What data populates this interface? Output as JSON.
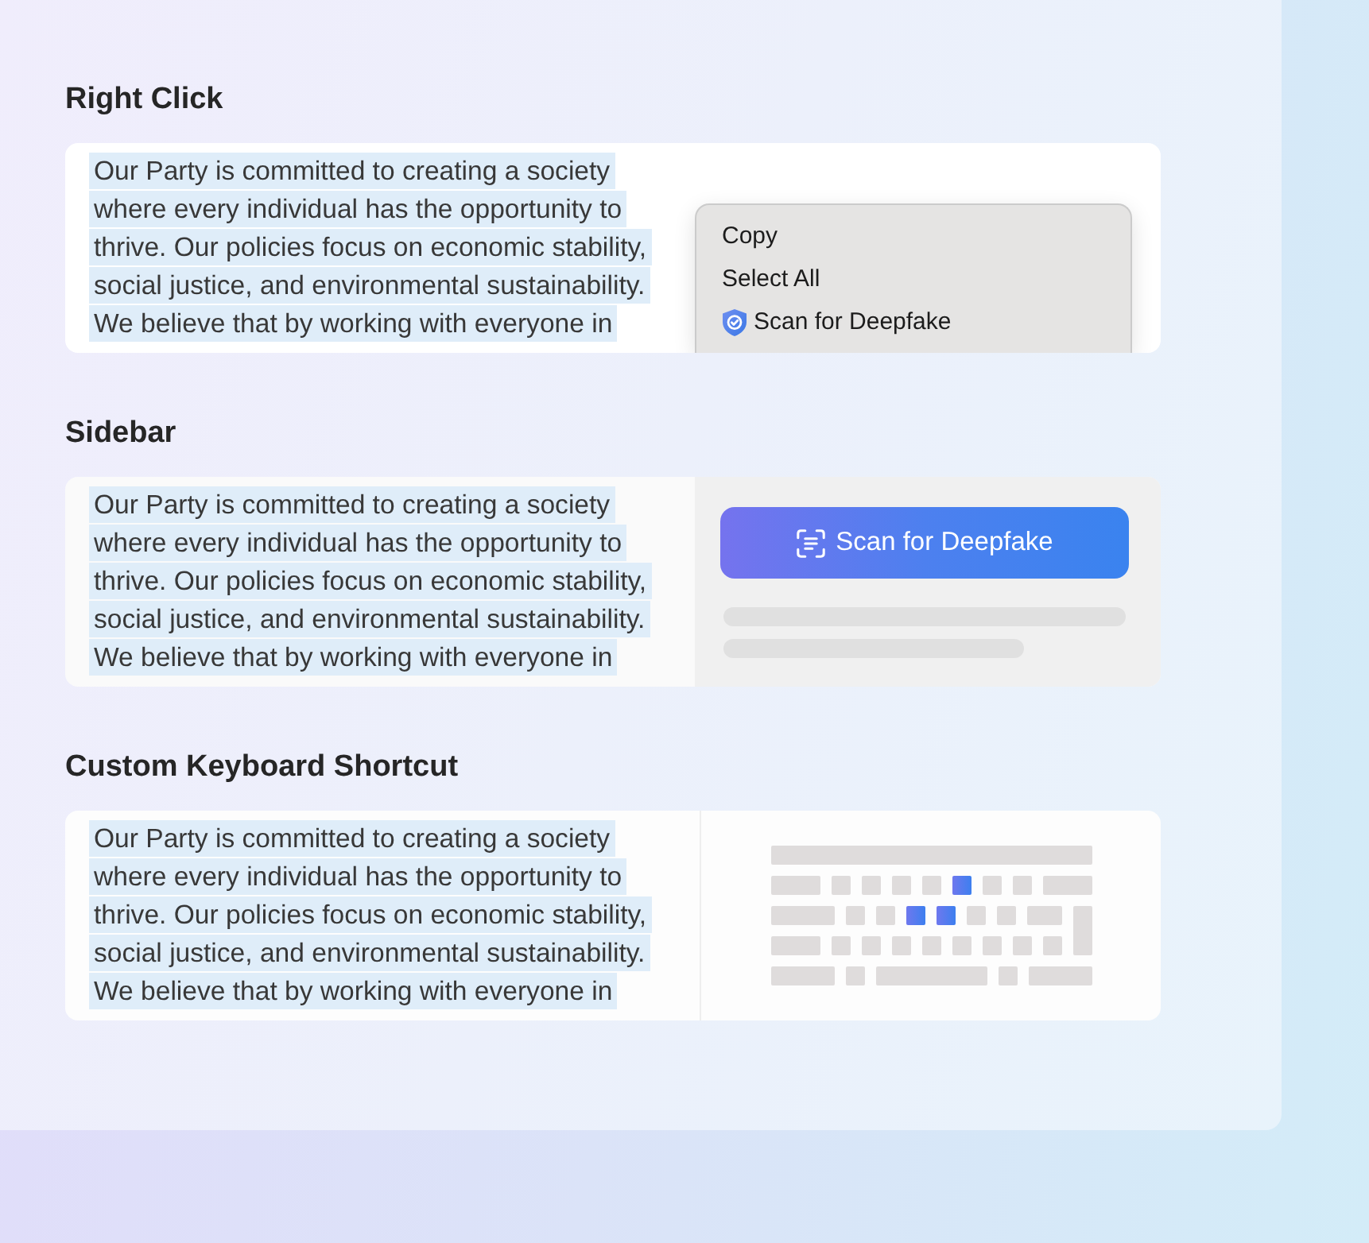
{
  "sections": [
    {
      "kind": "context_menu",
      "title": "Right Click",
      "passage": {
        "text": "Our Party is committed to creating a society\nwhere every individual has the opportunity to\nthrive. Our policies focus on economic stability,\nsocial justice, and environmental sustainability.\nWe believe that by working with everyone in",
        "selected": true
      },
      "menu": {
        "items": [
          {
            "kind": "command",
            "label": "Copy"
          },
          {
            "kind": "command",
            "label": "Select All"
          },
          {
            "kind": "extension",
            "label": "Scan for Deepfake"
          }
        ]
      }
    },
    {
      "kind": "sidebar",
      "title": "Sidebar",
      "passage": {
        "text": "Our Party is committed to creating a society\nwhere every individual has the opportunity to\nthrive. Our policies focus on economic stability,\nsocial justice, and environmental sustainability.\nWe believe that by working with everyone in",
        "selected": true
      },
      "button": {
        "label": "Scan for Deepfake"
      }
    },
    {
      "kind": "keyboard",
      "title": "Custom Keyboard Shortcut",
      "passage": {
        "text": "Our Party is committed to creating a society\nwhere every individual has the opportunity to\nthrive. Our policies focus on economic stability,\nsocial justice, and environmental sustainability.\nWe believe that by working with everyone in",
        "selected": true
      },
      "keyboard": {
        "rows": [
          {
            "keys": [
              {
                "kind": "bar",
                "selected": false
              }
            ]
          },
          {
            "keys": [
              {
                "kind": "wide",
                "selected": false
              },
              {
                "kind": "key",
                "selected": false
              },
              {
                "kind": "key",
                "selected": false
              },
              {
                "kind": "key",
                "selected": false
              },
              {
                "kind": "key",
                "selected": false
              },
              {
                "kind": "key",
                "selected": true
              },
              {
                "kind": "key",
                "selected": false
              },
              {
                "kind": "key",
                "selected": false
              },
              {
                "kind": "wide",
                "selected": false
              }
            ]
          },
          {
            "keys": [
              {
                "kind": "wider",
                "selected": false
              },
              {
                "kind": "key",
                "selected": false
              },
              {
                "kind": "key",
                "selected": false
              },
              {
                "kind": "key",
                "selected": true
              },
              {
                "kind": "key",
                "selected": true
              },
              {
                "kind": "key",
                "selected": false
              },
              {
                "kind": "key",
                "selected": false
              },
              {
                "kind": "medium",
                "selected": false
              },
              {
                "kind": "tall",
                "selected": false
              }
            ]
          },
          {
            "keys": [
              {
                "kind": "wide",
                "selected": false
              },
              {
                "kind": "key",
                "selected": false
              },
              {
                "kind": "key",
                "selected": false
              },
              {
                "kind": "key",
                "selected": false
              },
              {
                "kind": "key",
                "selected": false
              },
              {
                "kind": "key",
                "selected": false
              },
              {
                "kind": "key",
                "selected": false
              },
              {
                "kind": "key",
                "selected": false
              },
              {
                "kind": "key",
                "selected": false
              }
            ]
          },
          {
            "keys": [
              {
                "kind": "wider",
                "selected": false
              },
              {
                "kind": "key",
                "selected": false
              },
              {
                "kind": "space",
                "selected": false
              },
              {
                "kind": "key",
                "selected": false
              },
              {
                "kind": "wider",
                "selected": false
              }
            ]
          }
        ]
      }
    }
  ]
}
